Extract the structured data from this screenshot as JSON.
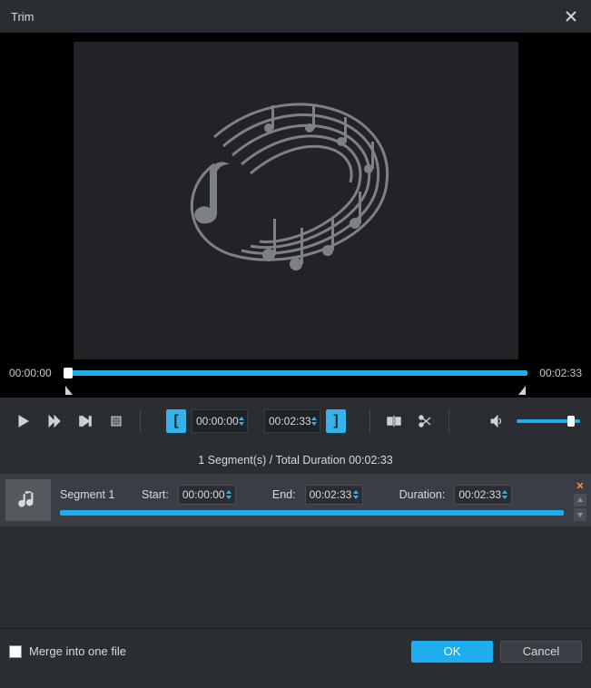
{
  "window": {
    "title": "Trim"
  },
  "preview": {
    "time_start": "00:00:00",
    "time_end": "00:02:33"
  },
  "controls": {
    "set_start_time": "00:00:00",
    "set_end_time": "00:02:33"
  },
  "segments_summary": "1 Segment(s) / Total Duration 00:02:33",
  "segment": {
    "name": "Segment 1",
    "start_label": "Start:",
    "start_value": "00:00:00",
    "end_label": "End:",
    "end_value": "00:02:33",
    "duration_label": "Duration:",
    "duration_value": "00:02:33"
  },
  "footer": {
    "merge_label": "Merge into one file",
    "ok": "OK",
    "cancel": "Cancel"
  }
}
